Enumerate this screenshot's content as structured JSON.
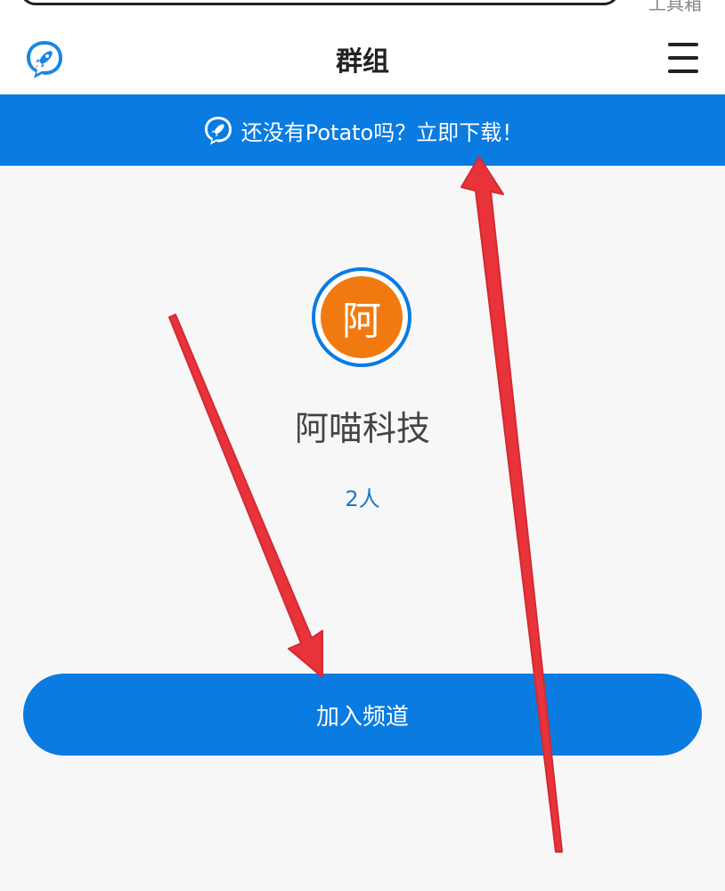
{
  "browser": {
    "top_right_text": "工具箱"
  },
  "header": {
    "title": "群组",
    "logo_icon": "potato-logo-icon",
    "menu_icon": "hamburger-menu-icon"
  },
  "banner": {
    "text": "还没有Potato吗？立即下载！",
    "icon": "potato-logo-icon"
  },
  "group": {
    "avatar_char": "阿",
    "name": "阿喵科技",
    "members": "2人"
  },
  "actions": {
    "join_label": "加入频道"
  },
  "colors": {
    "primary": "#0a7be1",
    "avatar": "#f07a10",
    "annotation": "#e8333a"
  }
}
